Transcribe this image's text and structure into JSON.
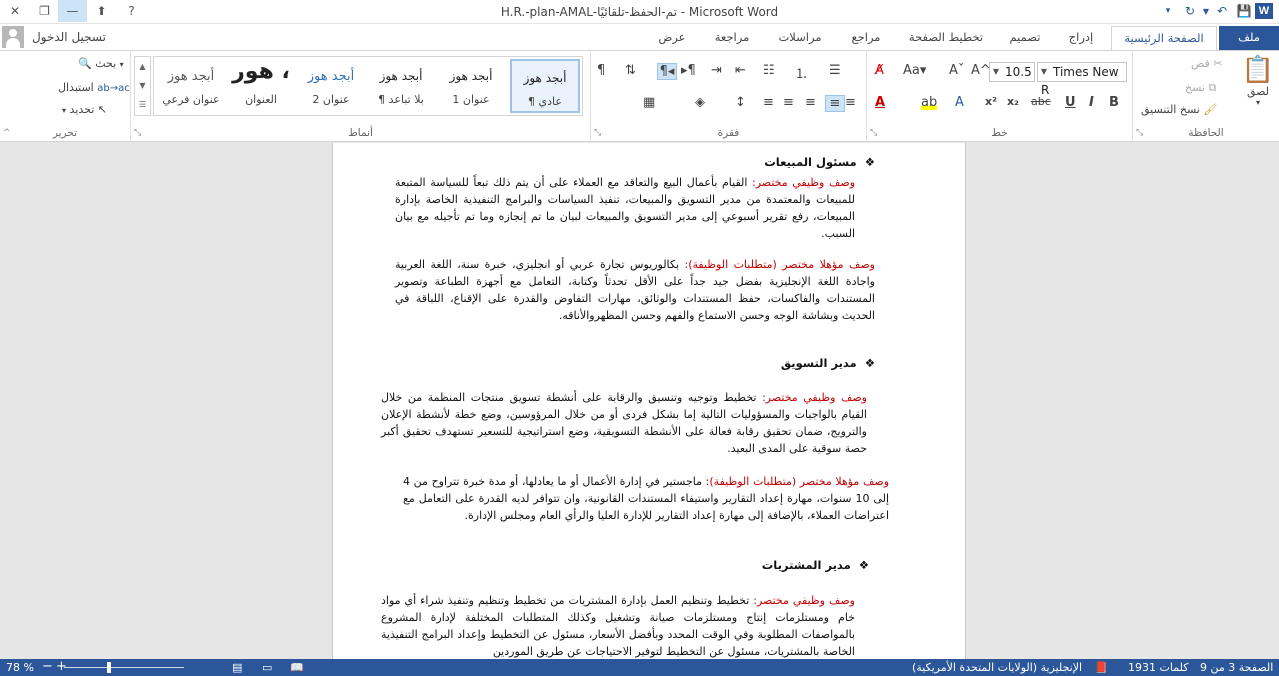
{
  "window": {
    "title": "H.R.-plan-AMAL-تم-الحفظ-تلقائيًا - Microsoft Word",
    "help": "?",
    "close": "✕",
    "restore": "❐",
    "minimize": "—",
    "ribbon_display": "⬆"
  },
  "signin": {
    "label": "تسجيل الدخول"
  },
  "tabs": [
    {
      "label": "ملف"
    },
    {
      "label": "الصفحة الرئيسية"
    },
    {
      "label": "إدراج"
    },
    {
      "label": "تصميم"
    },
    {
      "label": "تخطيط الصفحة"
    },
    {
      "label": "مراجع"
    },
    {
      "label": "مراسلات"
    },
    {
      "label": "مراجعة"
    },
    {
      "label": "عرض"
    }
  ],
  "ribbon": {
    "clipboard": {
      "label": "الحافظة",
      "paste": "لصق",
      "cut": "قص",
      "copy": "نسخ",
      "format_painter": "نسخ التنسيق"
    },
    "font": {
      "label": "خط",
      "name": "Times New R",
      "size": "10.5"
    },
    "paragraph": {
      "label": "فقرة"
    },
    "styles": {
      "label": "أنماط",
      "items": [
        {
          "sample": "أبجد هوز",
          "name": "¶ عادي"
        },
        {
          "sample": "أبجد هوز",
          "name": "عنوان 1"
        },
        {
          "sample": "أبجد هوز",
          "name": "¶ بلا تباعد"
        },
        {
          "sample": "أبجد هوز",
          "name": "عنوان 2"
        },
        {
          "sample": "هور ،",
          "name": "العنوان"
        },
        {
          "sample": "أبجد هوز",
          "name": "عنوان فرعي"
        }
      ]
    },
    "editing": {
      "label": "تحرير",
      "find": "بحث",
      "replace": "استبدال",
      "select": "تحديد"
    }
  },
  "document": {
    "sections": [
      {
        "heading": "مسئول المبيعات",
        "desc_label": "وصف وظيفي مختصر:",
        "desc_text": " القيام بأعمال البيع والتعاقد مع العملاء على أن يتم ذلك تبعاً للسياسة المتبعة للمبيعات والمعتمدة من مدير التسويق والمبيعات، تنفيذ السياسات والبرامج التنفيذية الخاصة بإدارة المبيعات، رفع تقرير أسبوعي إلى مدير التسويق والمبيعات لبيان ما تم إنجازه وما تم تأجيله مع بيان السبب.",
        "qual_label": "وصف مؤهلا مختصر (متطلبات الوظيفة):",
        "qual_text": " بكالوريوس تجارة عربي أو انجليزي، خبرة سنة، اللغة العربية واجادة اللغة الإنجليزية بفضل جيد جداً على الأقل تحدثاً وكتابة، التعامل مع أجهزة الطباعة وتصوير المستندات والفاكسات، حفظ المستندات والوثائق، مهارات التفاوض والقدرة على الإقناع، اللباقة في الحديث وبشاشة الوجه وحسن الاستماع والفهم وحسن المظهروالأناقه."
      },
      {
        "heading": "مدير التسويق",
        "desc_label": "وصف وظيفي مختصر:",
        "desc_text": " تخطيط وتوجيه وتنسيق والرقابة على أنشطة تسويق منتجات المنظمة من خلال القيام بالواجبات والمسؤوليات التالية إما بشكل فردى أو من خلال المرؤوسين، وضع خطة لأنشطة الإعلان والترويج، ضمان تحقيق رقابة فعالة على الأنشطة التسويقية، وضع استراتيجية للتسعير تستهدف تحقيق أكبر حصة سوقية على المدى البعيد.",
        "qual_label": "وصف مؤهلا مختصر (متطلبات الوظيفة):",
        "qual_text": " ماجستير في إدارة الأعمال أو ما يعادلها، أو مدة خبرة تتراوح من 4 إلى 10 سنوات، مهارة إعداد التقارير واستيفاء المستندات القانونية، وان تتوافر لديه القدرة على التعامل مع اعتراضات العملاء، بالإضافة إلى مهارة إعداد التقارير للإدارة العليا والرأي العام ومجلس الإدارة."
      },
      {
        "heading": "مدير المشتريات",
        "desc_label": "وصف وظيفي مختصر:",
        "desc_text": " تخطيط وتنظيم العمل بإدارة المشتريات من تخطيط وتنظيم وتنفيذ شراء أي مواد خام ومستلزمات إنتاج ومستلزمات صيانة وتشغيل وكذلك المتطلبات المختلفة لإدارة المشروع بالمواصفات المطلوبة وفي الوقت المحدد وبأفضل الأسعار، مسئول عن التخطيط وإعداد البرامج التنفيذية الخاصة بالمشتريات، مسئول عن التخطيط لتوفير الاحتياجات عن طريق الموردين"
      }
    ]
  },
  "status": {
    "page": "الصفحة 3 من 9",
    "words": "1931 كلمات",
    "language": "الإنجليزية (الولايات المتحدة الأمريكية)",
    "zoom": "78 %",
    "zoom_level": 0.78
  },
  "colors": {
    "brand": "#2b579a",
    "red_label": "#c00000"
  }
}
